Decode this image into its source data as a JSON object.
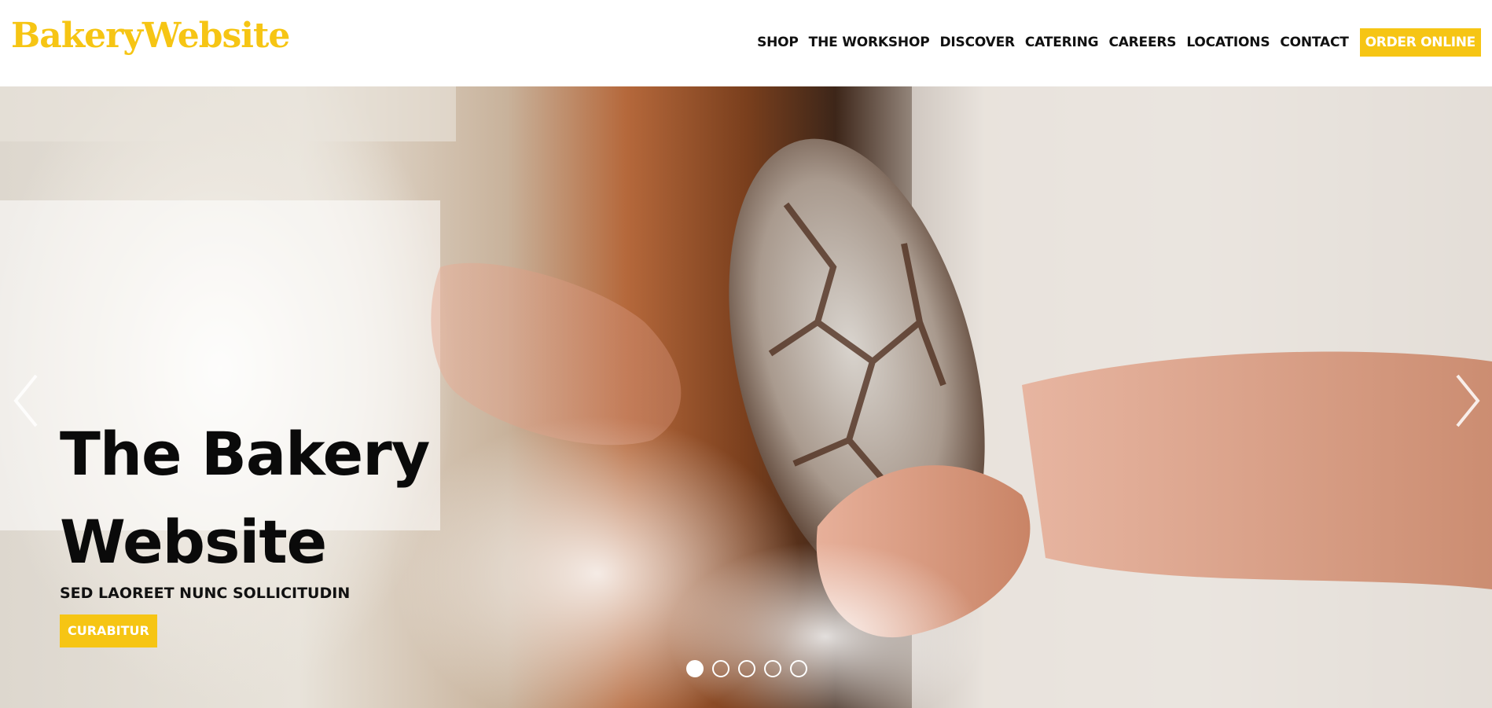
{
  "header": {
    "logo": "BakeryWebsite",
    "nav": [
      "SHOP",
      "THE WORKSHOP",
      "DISCOVER",
      "CATERING",
      "CAREERS",
      "LOCATIONS",
      "CONTACT"
    ],
    "order_button": "ORDER ONLINE"
  },
  "hero": {
    "title": "The Bakery Website",
    "subtitle": "SED LAOREET NUNC SOLLICITUDIN",
    "cta": "CURABITUR",
    "arrows": {
      "prev_icon": "chevron-left-icon",
      "next_icon": "chevron-right-icon"
    },
    "slider": {
      "total": 5,
      "active": 1
    }
  },
  "colors": {
    "accent": "#f6c514",
    "text": "#0a0a0a",
    "header_bg": "#ffffff"
  }
}
